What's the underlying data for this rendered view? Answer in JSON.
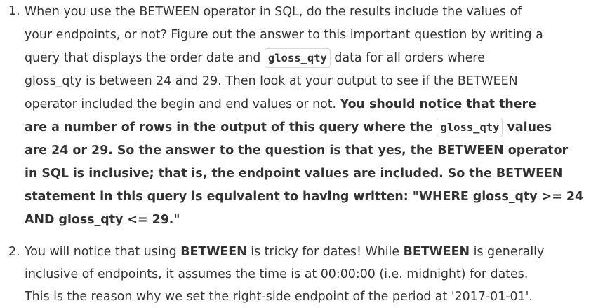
{
  "item1": {
    "number": "1.",
    "text_1": "When you use the BETWEEN operator in SQL, do the results include the values of",
    "text_2": "your endpoints, or not? Figure out the answer to this important question by writing a",
    "text_3a": "query that displays the order date and ",
    "code_1": "gloss_qty",
    "text_3b": " data for all orders where",
    "text_4": "gloss_qty is between 24 and 29. Then look at your output to see if the BETWEEN",
    "text_5a": "operator included the begin and end values or not. ",
    "bold_5b": "You should notice that there",
    "bold_6a": "are a number of rows in the output of this query where the ",
    "code_2": "gloss_qty",
    "bold_6b": " values",
    "bold_7": "are 24 or 29. So the answer to the question is that yes, the BETWEEN operator",
    "bold_8": "in SQL is inclusive; that is, the endpoint values are included. So the BETWEEN",
    "bold_9": "statement in this query is equivalent to having written: \"WHERE gloss_qty >= 24",
    "bold_10": "AND gloss_qty <= 29.\""
  },
  "item2": {
    "number": "2.",
    "text_1a": "You will notice that using ",
    "bold_1b": "BETWEEN",
    "text_1c": " is tricky for dates! While ",
    "bold_1d": "BETWEEN",
    "text_1e": " is generally",
    "text_2": "inclusive of endpoints, it assumes the time is at 00:00:00 (i.e. midnight) for dates.",
    "text_3": "This is the reason why we set the right-side endpoint of the period at '2017-01-01'."
  }
}
